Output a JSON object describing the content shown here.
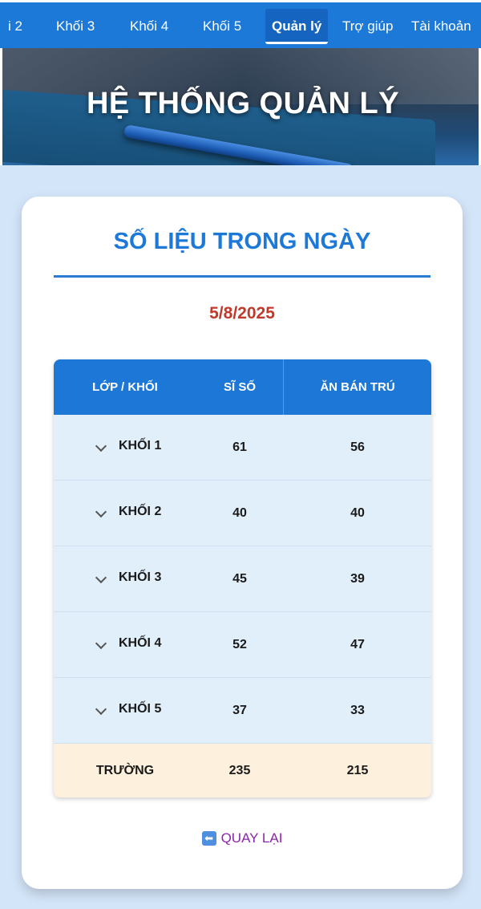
{
  "nav": {
    "items": [
      {
        "label": "i 2"
      },
      {
        "label": "Khối 3"
      },
      {
        "label": "Khối 4"
      },
      {
        "label": "Khối 5"
      },
      {
        "label": "Quản lý"
      },
      {
        "label": "Trợ giúp"
      },
      {
        "label": "Tài khoản"
      }
    ],
    "active": "Quản lý"
  },
  "hero": {
    "title": "HỆ THỐNG QUẢN LÝ"
  },
  "card": {
    "title": "SỐ LIỆU TRONG NGÀY",
    "date": "5/8/2025"
  },
  "table": {
    "headers": [
      "LỚP / KHỐI",
      "SĨ SỐ",
      "ĂN BÁN TRÚ"
    ],
    "rows": [
      {
        "grade": "KHỐI 1",
        "si_so": "61",
        "ban_tru": "56"
      },
      {
        "grade": "KHỐI 2",
        "si_so": "40",
        "ban_tru": "40"
      },
      {
        "grade": "KHỐI 3",
        "si_so": "45",
        "ban_tru": "39"
      },
      {
        "grade": "KHỐI 4",
        "si_so": "52",
        "ban_tru": "47"
      },
      {
        "grade": "KHỐI 5",
        "si_so": "37",
        "ban_tru": "33"
      }
    ],
    "total": {
      "label": "TRƯỜNG",
      "si_so": "235",
      "ban_tru": "215"
    }
  },
  "back": {
    "label": "QUAY LẠI",
    "icon": "left-arrow-icon"
  },
  "colors": {
    "primary": "#1d79d8",
    "date": "#c0392b",
    "back_link": "#8e24aa",
    "total_row": "#fdf0dc",
    "row_bg": "#e1effb"
  }
}
